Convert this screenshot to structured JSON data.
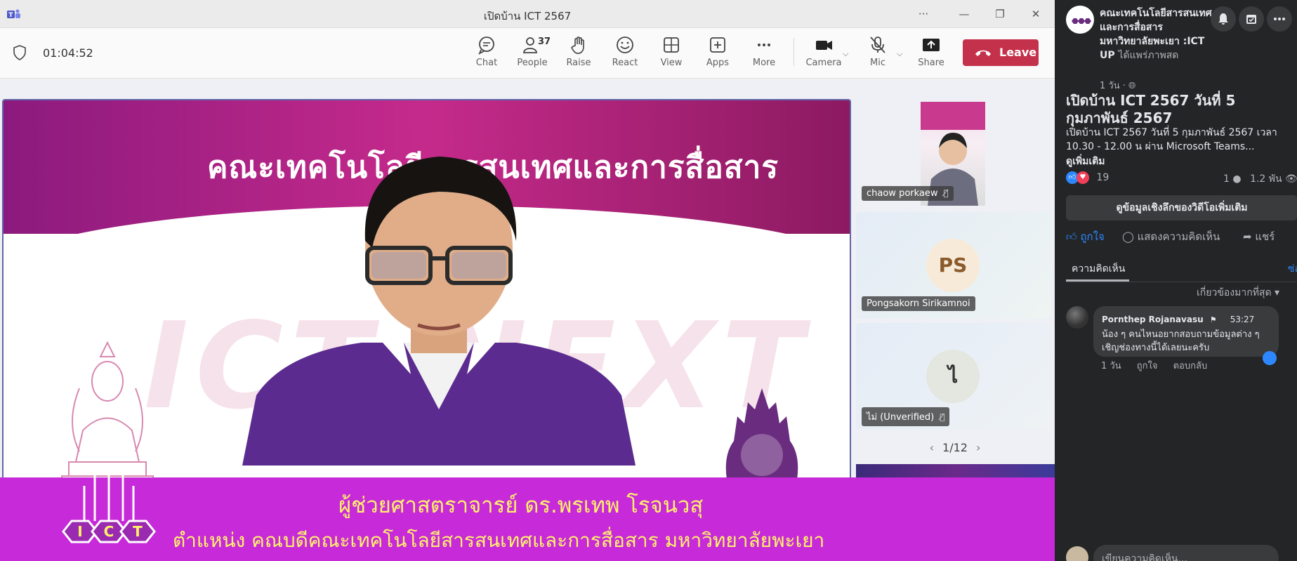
{
  "teams": {
    "window_title": "เปิดบ้าน ICT 2567",
    "window_controls": {
      "more": "···",
      "minimize": "—",
      "restore": "❐",
      "close": "✕"
    },
    "timer": "01:04:52",
    "toolbar": [
      {
        "id": "chat",
        "label": "Chat",
        "icon": "chat-icon"
      },
      {
        "id": "people",
        "label": "People",
        "icon": "people-icon",
        "count": "37"
      },
      {
        "id": "raise",
        "label": "Raise",
        "icon": "hand-icon"
      },
      {
        "id": "react",
        "label": "React",
        "icon": "smile-icon"
      },
      {
        "id": "view",
        "label": "View",
        "icon": "grid-icon"
      },
      {
        "id": "apps",
        "label": "Apps",
        "icon": "plus-icon"
      },
      {
        "id": "more",
        "label": "More",
        "icon": "ellipsis-icon"
      },
      {
        "id": "camera",
        "label": "Camera",
        "icon": "camera-icon"
      },
      {
        "id": "mic",
        "label": "Mic",
        "icon": "mic-off-icon"
      },
      {
        "id": "share",
        "label": "Share",
        "icon": "share-icon"
      }
    ],
    "leave_label": "Leave",
    "leave_color": "#c4314b",
    "main_video": {
      "banner_text": "คณะเทคโนโลยีสารสนเทศและการสื่อสาร",
      "bg_text": "ICT NEXT",
      "caption_line1": "ผู้ช่วยศาสตราจารย์ ดร.พรเทพ  โรจนวสุ",
      "caption_line2": "ตำแหน่ง คณบดีคณะเทคโนโลยีสารสนเทศและการสื่อสาร มหาวิทยาลัยพะเยา"
    },
    "participants": [
      {
        "name": "chaow porkaew",
        "muted": true
      },
      {
        "name": "Pongsakorn Sirikamnoi",
        "initials": "PS",
        "avatar_bg": "#f7ead8",
        "avatar_fg": "#8a5a2b"
      },
      {
        "name": "ไม่ (Unverified)",
        "initials": "ไ",
        "avatar_bg": "#e3e7e0",
        "avatar_fg": "#333",
        "muted": true
      }
    ],
    "pager": "1/12",
    "lower_third_color": "#c62ad9",
    "accent": "#6264a7"
  },
  "facebook": {
    "page_name": "คณะเทคโนโลยีสารสนเทศและการสื่อสาร มหาวิทยาลัยพะเยา :ICT UP",
    "live_text": "ได้แพร่ภาพสด",
    "post_age": "1 วัน ·",
    "video_title": "เปิดบ้าน ICT 2567 วันที่ 5 กุมภาพันธ์ 2567",
    "video_desc": "เปิดบ้าน ICT 2567 วันที่ 5 กุมภาพันธ์ 2567 เวลา 10.30 - 12.00 น ผ่าน Microsoft Teams...",
    "see_more": "ดูเพิ่มเติม",
    "reaction_count": "19",
    "comment_count": "1",
    "view_count": "1.2 พัน",
    "insight_button": "ดูข้อมูลเชิงลึกของวิดีโอเพิ่มเติม",
    "actions": {
      "like": "ถูกใจ",
      "comment": "แสดงความคิดเห็น",
      "share": "แชร์"
    },
    "comments_tab": "ความคิดเห็น",
    "hide_label": "ซ่อน",
    "sort_label": "เกี่ยวข้องมากที่สุด",
    "comment": {
      "author": "Pornthep Rojanavasu",
      "time": "53:27",
      "text": "น้อง ๆ คนไหนอยากสอบถามข้อมูลต่าง ๆ เชิญช่องทางนี้ได้เลยนะครับ",
      "age": "1 วัน",
      "like": "ถูกใจ",
      "reply": "ตอบกลับ"
    },
    "write_placeholder": "เขียนความคิดเห็น...",
    "accent": "#2d88ff"
  }
}
